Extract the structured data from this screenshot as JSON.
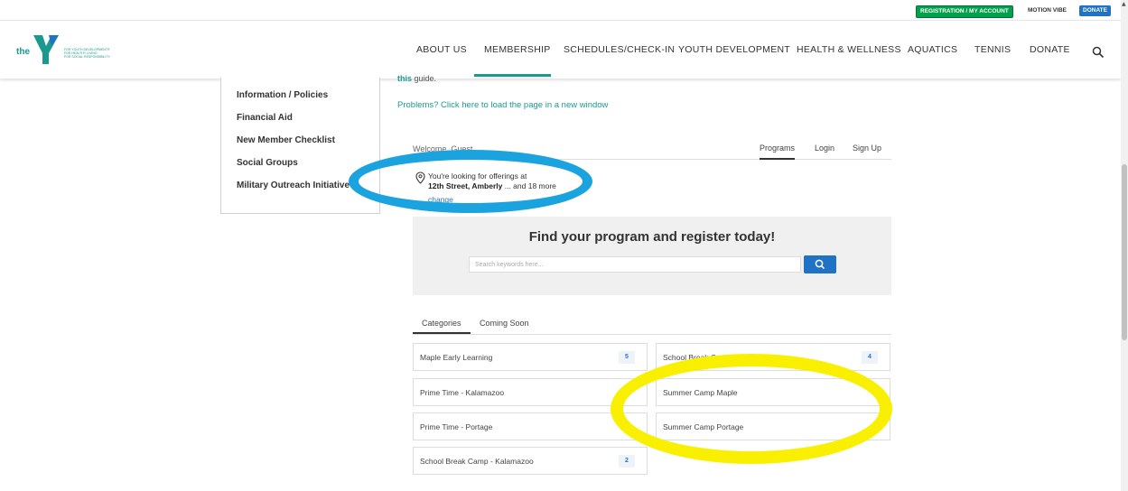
{
  "utility": {
    "registration": "REGISTRATION / MY ACCOUNT",
    "motion_vibe": "MOTION VIBE",
    "donate": "DONATE"
  },
  "brand": {
    "the": "the",
    "tag1": "FOR YOUTH DEVELOPMENT®",
    "tag2": "FOR HEALTHY LIVING",
    "tag3": "FOR SOCIAL RESPONSIBILITY",
    "color": "#1a9a8f"
  },
  "nav": {
    "items": [
      "ABOUT US",
      "MEMBERSHIP",
      "SCHEDULES/CHECK-IN",
      "YOUTH DEVELOPMENT",
      "HEALTH & WELLNESS",
      "AQUATICS",
      "TENNIS",
      "DONATE"
    ],
    "active": "MEMBERSHIP"
  },
  "sidebar": {
    "items": [
      "Information / Policies",
      "Financial Aid",
      "New Member Checklist",
      "Social Groups",
      "Military Outreach Initiative"
    ]
  },
  "content": {
    "guide_link": "this",
    "guide_text": " guide.",
    "problems": "Problems? Click here to load the page in a new window"
  },
  "widget": {
    "welcome": "Welcome, Guest",
    "tabs": [
      "Programs",
      "Login",
      "Sign Up"
    ],
    "location_line1": "You're looking for offerings at",
    "location_place": "12th Street, Amberly",
    "location_more": " ... and 18 more",
    "change": "change",
    "find_title": "Find your program and register today!",
    "search_placeholder": "Search keywords here...",
    "cat_tabs": [
      "Categories",
      "Coming Soon"
    ],
    "categories": [
      {
        "label": "Maple Early Learning",
        "count": "5"
      },
      {
        "label": "School Break Camp - Portage",
        "count": "4"
      },
      {
        "label": "Prime Time - Kalamazoo",
        "count": ""
      },
      {
        "label": "Summer Camp Maple",
        "count": ""
      },
      {
        "label": "Prime Time - Portage",
        "count": ""
      },
      {
        "label": "Summer Camp Portage",
        "count": ""
      },
      {
        "label": "School Break Camp - Kalamazoo",
        "count": "2"
      }
    ]
  },
  "annotation_colors": {
    "blue": "#1aa3de",
    "yellow": "#f8f000"
  }
}
